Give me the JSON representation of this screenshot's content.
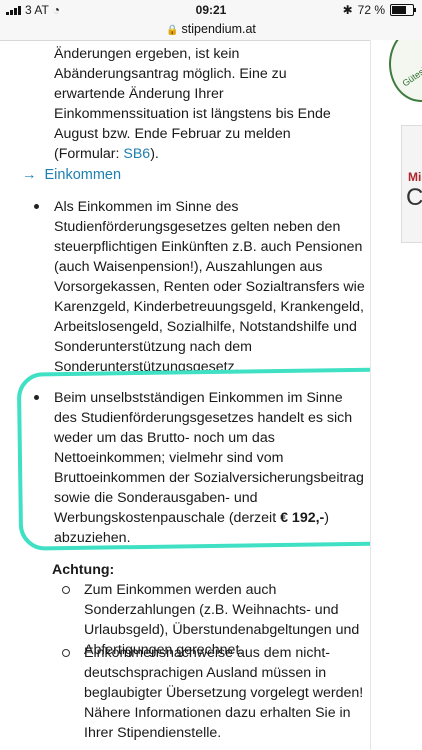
{
  "status": {
    "carrier": "3 AT",
    "time": "09:21",
    "battery": "72 %",
    "battery_level": 0.72
  },
  "url": "stipendium.at",
  "top_paragraph": {
    "line1": "Änderungen ergeben, ist kein",
    "line2": "Abänderungsantrag möglich. Eine zu",
    "line3": "erwartende Änderung Ihrer",
    "line4": "Einkommenssituation ist längstens bis Ende",
    "line5": "August bzw. Ende Februar zu melden",
    "line6_prefix": "(Formular: ",
    "line6_link": "SB6",
    "line6_suffix": ")."
  },
  "section_link": "Einkommen",
  "bullet1": "Als Einkommen im Sinne des Studienförderungsgesetzes gelten neben den steuerpflichtigen Einkünften z.B. auch Pensionen (auch Waisenpension!), Auszahlungen aus Vorsorgekassen, Renten oder Sozialtransfers wie Karenzgeld, Kinderbetreuungsgeld, Krankengeld, Arbeitslosengeld, Sozialhilfe, Notstandshilfe und Sonderunterstützung nach dem Sonderunterstützungsgesetz.",
  "bullet2": {
    "text": "Beim unselbstständigen Einkommen im Sinne des Studienförderungsgesetzes handelt es sich weder um das Brutto- noch um das Nettoeinkommen; vielmehr sind vom Bruttoeinkommen der Sozialversicherungsbeitrag sowie die Sonderausgaben- und Werbungskostenpauschale (derzeit ",
    "amount": "€ 192,-",
    "end": ") abzuziehen."
  },
  "achtung": "Achtung:",
  "sub1": "Zum Einkommen werden auch Sonderzahlungen (z.B. Weihnachts- und Urlaubsgeld), Überstundenabgeltungen und Abfertigungen gerechnet.",
  "sub2": "Einkommensnachweise aus dem nicht-deutschsprachigen Ausland müssen in beglaubigter Übersetzung vorgelegt werden! Nähere Informationen dazu erhalten Sie in Ihrer Stipendienstelle.",
  "ad": {
    "seal_text": "Gütesi",
    "card_text1": "Mi",
    "card_text2": "C"
  },
  "colors": {
    "link": "#1d7fb0",
    "highlight": "#3fe0c4"
  }
}
